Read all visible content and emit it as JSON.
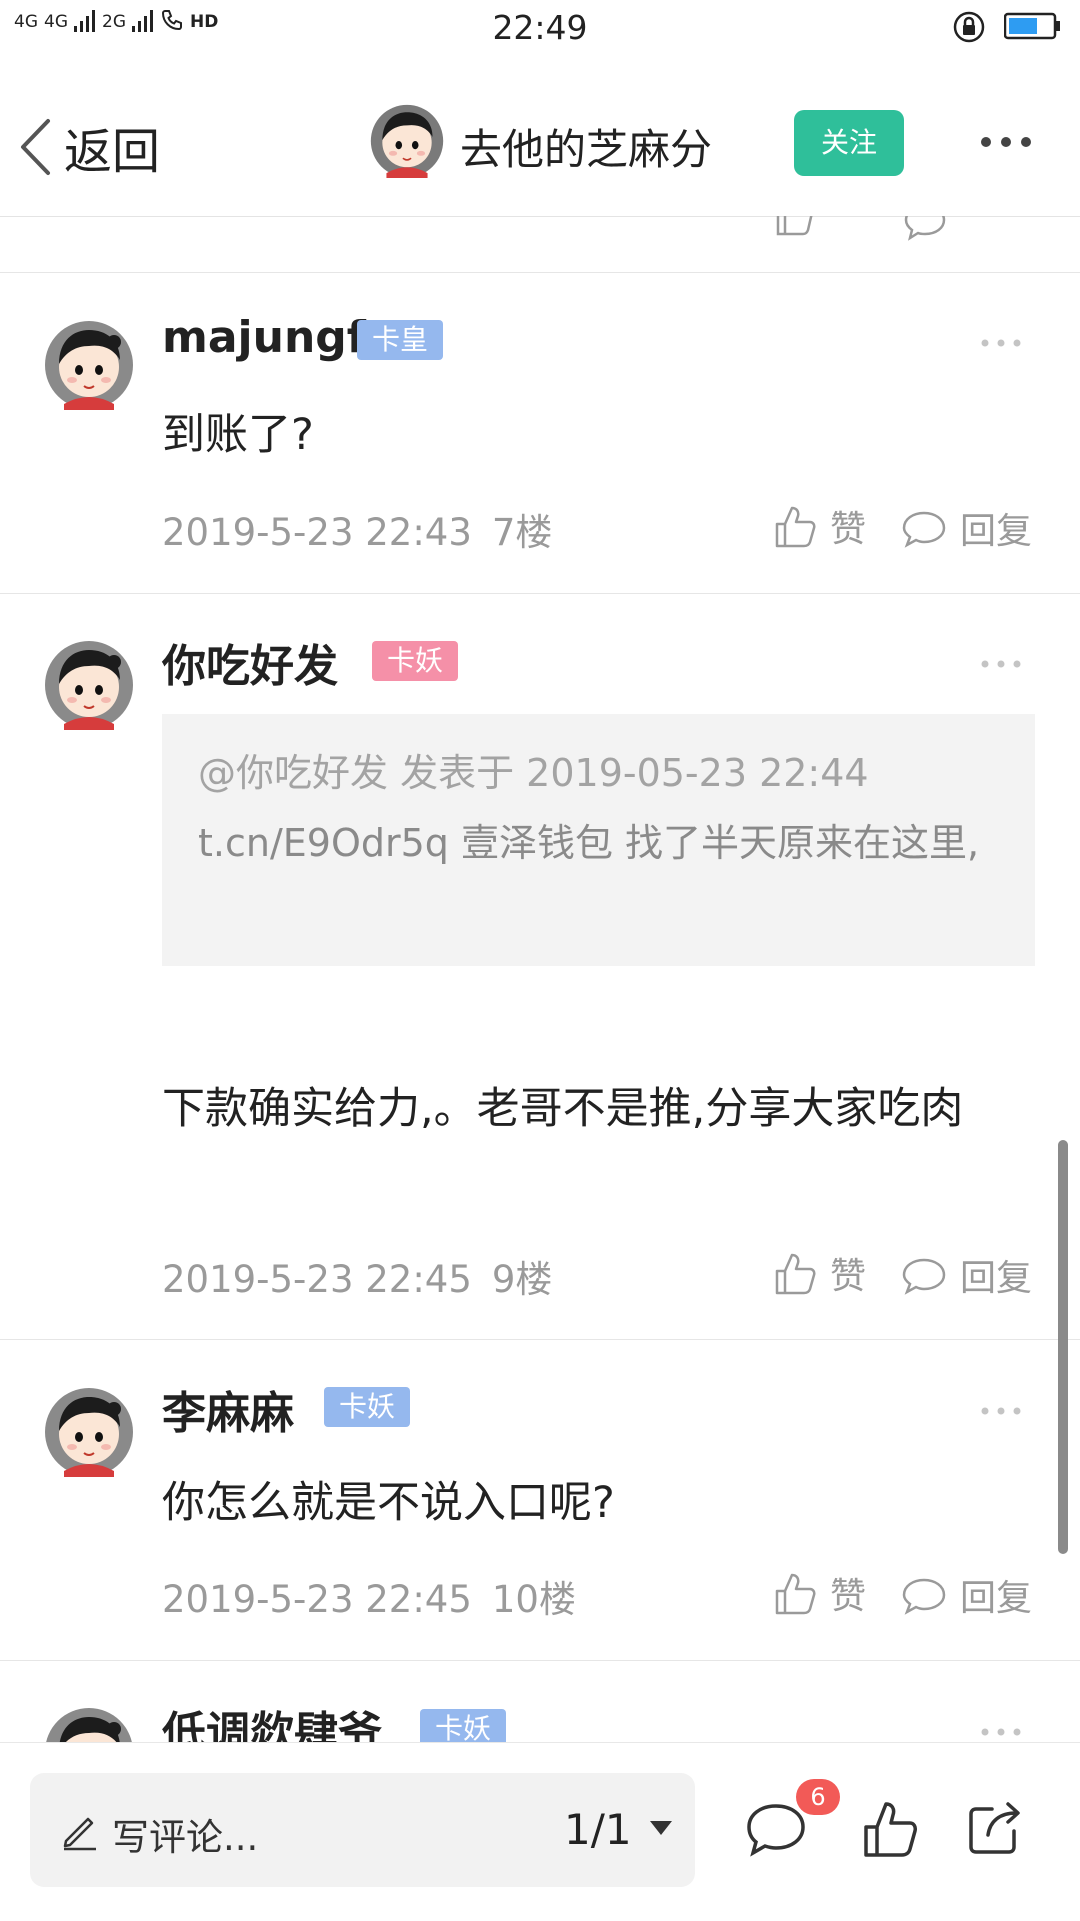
{
  "status_bar": {
    "signal_1": "4G",
    "signal_2": "4G",
    "signal_3": "2G",
    "hd": "HD",
    "time": "22:49",
    "icons": [
      "rotation-lock-icon",
      "battery-icon"
    ]
  },
  "nav": {
    "back_label": "返回",
    "title": "去他的芝麻分",
    "follow_label": "关注",
    "more_icon": "more-dots-icon"
  },
  "posts": [
    {
      "username": "majungf",
      "badge": "卡皇",
      "badge_color": "#95b8ee",
      "content": "到账了?",
      "time": "2019-5-23 22:43",
      "floor": "7楼",
      "like_label": "赞",
      "reply_label": "回复"
    },
    {
      "username": "你吃好发",
      "badge": "卡妖",
      "badge_color": "#f590a8",
      "quote_head": "@你吃好发 发表于 2019-05-23 22:44",
      "quote_body": "t.cn/E9Odr5q    壹泽钱包  找了半天原来在这里,",
      "content": "下款确实给力,。老哥不是推,分享大家吃肉",
      "time": "2019-5-23 22:45",
      "floor": "9楼",
      "like_label": "赞",
      "reply_label": "回复"
    },
    {
      "username": "李麻麻",
      "badge": "卡妖",
      "badge_color": "#95b8ee",
      "content": "你怎么就是不说入口呢?",
      "time": "2019-5-23 22:45",
      "floor": "10楼",
      "like_label": "赞",
      "reply_label": "回复"
    },
    {
      "username": "低调欻肆爷",
      "badge": "卡妖",
      "badge_color": "#95b8ee"
    }
  ],
  "bottom_bar": {
    "write_label": "写评论...",
    "page_indicator": "1/1",
    "comment_count": "6",
    "icons": [
      "comment-icon",
      "like-icon",
      "share-icon"
    ]
  },
  "colors": {
    "accent": "#2fbf9a",
    "badge_blue": "#95b8ee",
    "badge_pink": "#f590a8",
    "notification": "#f25a57",
    "muted_text": "#9a9a9a"
  }
}
